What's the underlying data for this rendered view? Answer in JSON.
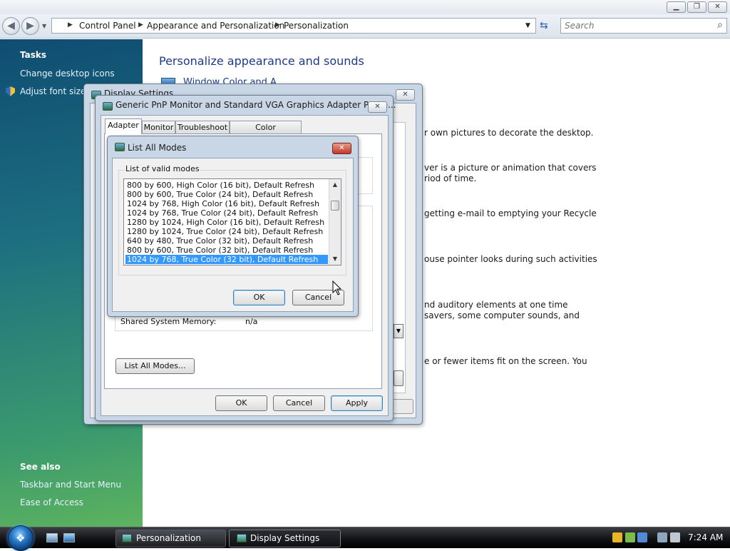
{
  "window": {
    "minimize": "▁",
    "maximize": "❐",
    "close": "✕"
  },
  "address": {
    "crumbs": [
      "Control Panel",
      "Appearance and Personalization",
      "Personalization"
    ],
    "dropdown_icon": "▼",
    "refresh_icon": "⇆",
    "back_icon": "◀",
    "forward_icon": "▶"
  },
  "search": {
    "placeholder": "Search",
    "icon": "⌕"
  },
  "left_pane": {
    "tasks_heading": "Tasks",
    "tasks": [
      "Change desktop icons",
      "Adjust font size ("
    ],
    "see_also_heading": "See also",
    "see_also": [
      "Taskbar and Start Menu",
      "Ease of Access"
    ]
  },
  "main": {
    "title": "Personalize appearance and sounds",
    "partial_link": "Window Color and A",
    "descriptions": [
      "r own pictures to decorate the desktop.",
      "ver is a picture or animation that covers",
      "riod of time.",
      "getting e-mail to emptying your Recycle",
      "ouse pointer looks during such activities",
      "nd auditory elements at one time",
      " savers, some computer sounds, and",
      "e or fewer items fit on the screen. You"
    ]
  },
  "display_settings": {
    "title": "Display Settings",
    "close": "✕"
  },
  "properties": {
    "title": "Generic PnP Monitor and Standard VGA Graphics Adapter Prope...",
    "close": "✕",
    "tabs": [
      "Adapter",
      "Monitor",
      "Troubleshoot",
      "Color Management"
    ],
    "shared_memory_label": "Shared System Memory:",
    "shared_memory_value": "n/a",
    "list_all_modes": "List All Modes...",
    "ok": "OK",
    "cancel": "Cancel",
    "apply": "Apply"
  },
  "list_all_modes": {
    "title": "List All Modes",
    "close": "✕",
    "group_label": "List of valid modes",
    "modes": [
      "800 by 600, High Color (16 bit), Default Refresh",
      "800 by 600, True Color (24 bit), Default Refresh",
      "1024 by 768, High Color (16 bit), Default Refresh",
      "1024 by 768, True Color (24 bit), Default Refresh",
      "1280 by 1024, High Color (16 bit), Default Refresh",
      "1280 by 1024, True Color (24 bit), Default Refresh",
      "640 by 480, True Color (32 bit), Default Refresh",
      "800 by 600, True Color (32 bit), Default Refresh",
      "1024 by 768, True Color (32 bit), Default Refresh"
    ],
    "selected_index": 8,
    "scroll_up": "▲",
    "scroll_down": "▼",
    "ok": "OK",
    "cancel": "Cancel"
  },
  "taskbar": {
    "start_icon": "❖",
    "items": [
      "Personalization",
      "Display Settings"
    ],
    "active_index": 1,
    "clock": "7:24 AM"
  },
  "colors": {
    "selection": "#3399ff",
    "link_title": "#1e3a8a",
    "left_pane_top": "#0f4d72",
    "left_pane_bottom": "#5db35e"
  }
}
